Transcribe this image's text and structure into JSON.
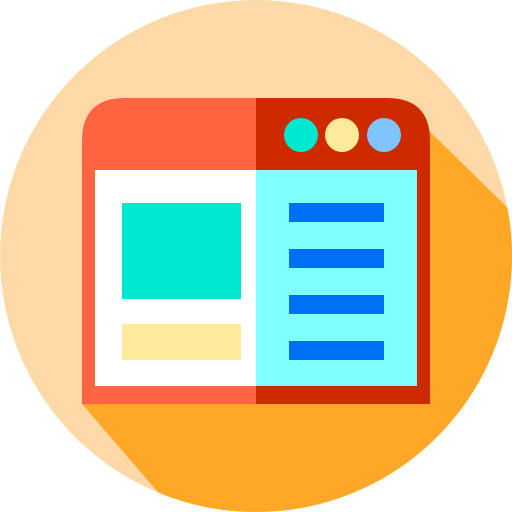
{
  "icon": {
    "name": "browser-window-layout-icon",
    "colors": {
      "circle_background": "#FED9A8",
      "long_shadow": "#FFA726",
      "frame_left": "#FF6440",
      "frame_right": "#CD2A00",
      "pane_left": "#FFFFFF",
      "pane_right": "#80FFFF",
      "image_block": "#00E7CF",
      "caption_block": "#FFEA9C",
      "text_lines": "#0070F6",
      "dot_1": "#00E7CF",
      "dot_2": "#FFEA9C",
      "dot_3": "#80C4FF"
    },
    "window_control_dots": 3,
    "text_line_count": 4
  }
}
